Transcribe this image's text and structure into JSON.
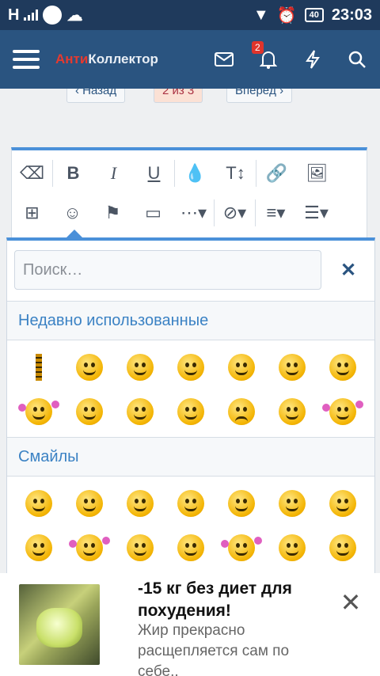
{
  "status": {
    "carrier": "H",
    "battery": "40",
    "time": "23:03"
  },
  "header": {
    "logo_part1": "Анти",
    "logo_part2": "Коллектор",
    "notif_count": "2",
    "icons": [
      "menu-icon",
      "mail-icon",
      "bell-icon",
      "lightning-icon",
      "search-icon"
    ]
  },
  "pager": {
    "prev": "‹ Назад",
    "current": "2 из 3",
    "next": "Вперёд ›"
  },
  "editor": {
    "row1": [
      "eraser-icon",
      "bold-icon",
      "italic-icon",
      "underline-icon",
      "color-drop-icon",
      "text-size-icon",
      "link-icon",
      "image-icon"
    ],
    "row2": [
      "video-icon",
      "smiley-icon",
      "flag-icon",
      "media-icon",
      "more-icon",
      "hide-icon",
      "align-icon",
      "list-icon"
    ]
  },
  "emoji_popup": {
    "search_placeholder": "Поиск…",
    "recent_label": "Недавно использованные",
    "smilies_label": "Смайлы",
    "recent_count": 14,
    "smilies_count": 14
  },
  "ad": {
    "title": "-15 кг без диет для похудения!",
    "text": "Жир прекрасно расщепляется сам по себе.."
  },
  "colors": {
    "statusbar": "#1f3a5c",
    "appbar": "#2a5480",
    "accent": "#4a90d9",
    "section_text": "#3b82c4",
    "logo_red": "#e53a2f"
  }
}
